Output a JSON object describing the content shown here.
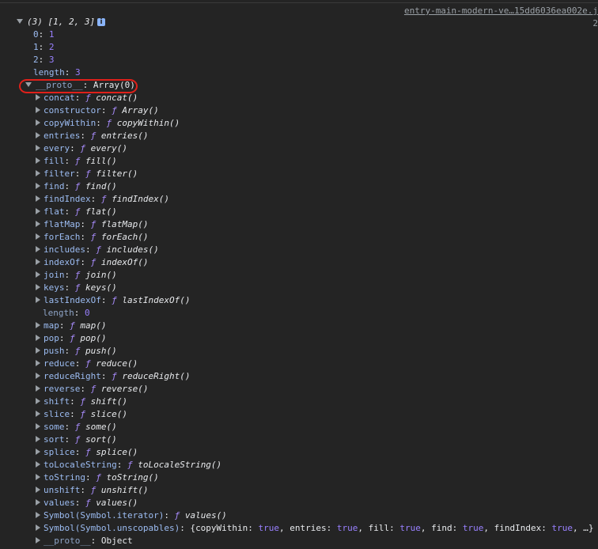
{
  "source_link": "entry-main-modern-ve…15dd6036ea002e.j",
  "source_line2": "2",
  "root": {
    "summary": "(3) [1, 2, 3]",
    "info_glyph": "i"
  },
  "entries": [
    {
      "key": "0",
      "value": "1"
    },
    {
      "key": "1",
      "value": "2"
    },
    {
      "key": "2",
      "value": "3"
    },
    {
      "key": "length",
      "value": "3"
    }
  ],
  "proto": {
    "key": "__proto__",
    "value": "Array(0)"
  },
  "methods": [
    {
      "key": "concat",
      "fn": "concat()"
    },
    {
      "key": "constructor",
      "fn": "Array()"
    },
    {
      "key": "copyWithin",
      "fn": "copyWithin()"
    },
    {
      "key": "entries",
      "fn": "entries()"
    },
    {
      "key": "every",
      "fn": "every()"
    },
    {
      "key": "fill",
      "fn": "fill()"
    },
    {
      "key": "filter",
      "fn": "filter()"
    },
    {
      "key": "find",
      "fn": "find()"
    },
    {
      "key": "findIndex",
      "fn": "findIndex()"
    },
    {
      "key": "flat",
      "fn": "flat()"
    },
    {
      "key": "flatMap",
      "fn": "flatMap()"
    },
    {
      "key": "forEach",
      "fn": "forEach()"
    },
    {
      "key": "includes",
      "fn": "includes()"
    },
    {
      "key": "indexOf",
      "fn": "indexOf()"
    },
    {
      "key": "join",
      "fn": "join()"
    },
    {
      "key": "keys",
      "fn": "keys()"
    },
    {
      "key": "lastIndexOf",
      "fn": "lastIndexOf()"
    }
  ],
  "proto_length": {
    "key": "length",
    "value": "0"
  },
  "methods2": [
    {
      "key": "map",
      "fn": "map()"
    },
    {
      "key": "pop",
      "fn": "pop()"
    },
    {
      "key": "push",
      "fn": "push()"
    },
    {
      "key": "reduce",
      "fn": "reduce()"
    },
    {
      "key": "reduceRight",
      "fn": "reduceRight()"
    },
    {
      "key": "reverse",
      "fn": "reverse()"
    },
    {
      "key": "shift",
      "fn": "shift()"
    },
    {
      "key": "slice",
      "fn": "slice()"
    },
    {
      "key": "some",
      "fn": "some()"
    },
    {
      "key": "sort",
      "fn": "sort()"
    },
    {
      "key": "splice",
      "fn": "splice()"
    },
    {
      "key": "toLocaleString",
      "fn": "toLocaleString()"
    },
    {
      "key": "toString",
      "fn": "toString()"
    },
    {
      "key": "unshift",
      "fn": "unshift()"
    },
    {
      "key": "values",
      "fn": "values()"
    },
    {
      "key": "Symbol(Symbol.iterator)",
      "fn": "values()"
    }
  ],
  "unscopables": {
    "key": "Symbol(Symbol.unscopables)",
    "pairs": [
      {
        "k": "copyWithin",
        "v": "true"
      },
      {
        "k": "entries",
        "v": "true"
      },
      {
        "k": "fill",
        "v": "true"
      },
      {
        "k": "find",
        "v": "true"
      },
      {
        "k": "findIndex",
        "v": "true"
      }
    ],
    "tail": "…}"
  },
  "inner_proto": {
    "key": "__proto__",
    "value": "Object"
  },
  "f_glyph": "ƒ",
  "colors": {
    "background": "#242424",
    "key": "#9cbcf2",
    "number": "#9980ff",
    "annotation": "#e0201a"
  }
}
